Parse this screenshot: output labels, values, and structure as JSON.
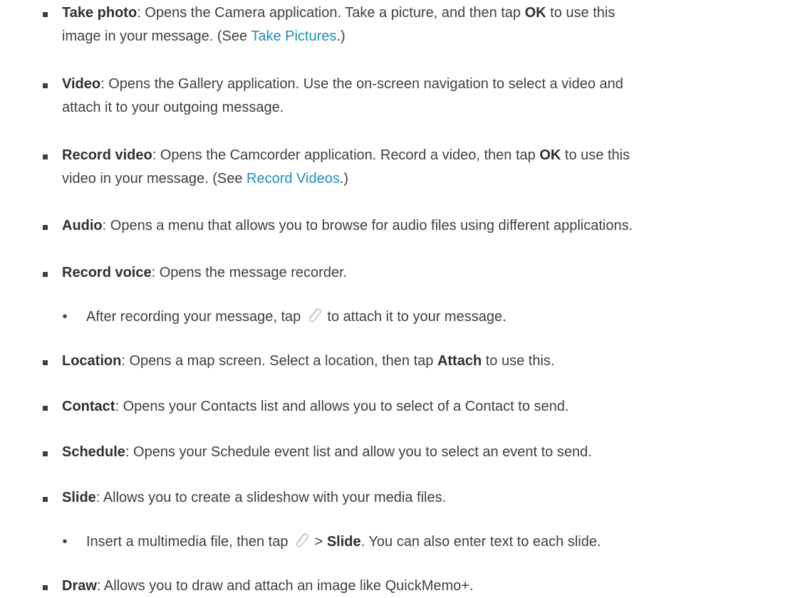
{
  "items": [
    {
      "label": "Take photo",
      "pre": ": Opens the Camera application. Take a picture, and then tap ",
      "bold2": "OK",
      "post": " to use this",
      "line2_pre": "image in your message. (See ",
      "link": "Take Pictures",
      "line2_post": ".)"
    },
    {
      "label": "Video",
      "line1": ": Opens the Gallery application. Use the on-screen navigation to select a video and",
      "line2": "attach it to your outgoing message."
    },
    {
      "label": "Record video",
      "pre": ": Opens the Camcorder application. Record a video, then tap ",
      "bold2": "OK",
      "post": " to use this",
      "line2_pre": "video in your message. (See ",
      "link": "Record Videos",
      "line2_post": ".)"
    },
    {
      "label": "Audio",
      "line1": ": Opens a menu that allows you to browse for audio files using different applications."
    },
    {
      "label": "Record voice",
      "line1": ": Opens the message recorder."
    },
    {
      "sub_pre": "After recording your message, tap ",
      "sub_post": " to attach it to your message.",
      "icon": "paperclip-icon"
    },
    {
      "label": "Location",
      "pre": ": Opens a map screen. Select a location, then tap ",
      "bold2": "Attach",
      "post": " to use this."
    },
    {
      "label": "Contact",
      "line1": ": Opens your Contacts list and allows you to select of a Contact to send."
    },
    {
      "label": "Schedule",
      "line1": ": Opens your Schedule event list and allow you to select an event to send."
    },
    {
      "label": "Slide",
      "line1": ": Allows you to create a slideshow with your media files."
    },
    {
      "sub_pre": "Insert a multimedia file, then tap ",
      "sub_mid": " > ",
      "sub_bold": "Slide",
      "sub_post": ". You can also enter text to each slide.",
      "icon": "paperclip-icon"
    },
    {
      "label": "Draw",
      "line1": ": Allows you to draw and attach an image like QuickMemo+."
    }
  ],
  "bullet_char": "•",
  "colors": {
    "text": "#3f3f3f",
    "link": "#1f8fb8",
    "icon": "#c4c4c4"
  }
}
